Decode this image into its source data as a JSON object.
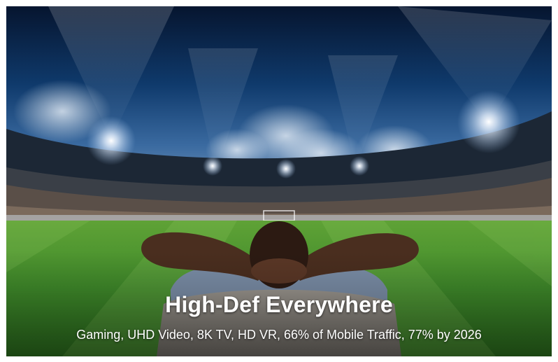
{
  "slide": {
    "title": "High-Def Everywhere",
    "subtitle": "Gaming, UHD Video, 8K TV, HD VR, 66% of Mobile Traffic, 77% by 2026"
  },
  "colors": {
    "sky": "#0a2346",
    "grass": "#3f8a2a",
    "text": "#ffffff"
  },
  "photo": {
    "subject": "person-leaning-back-in-chair-facing-stadium"
  }
}
